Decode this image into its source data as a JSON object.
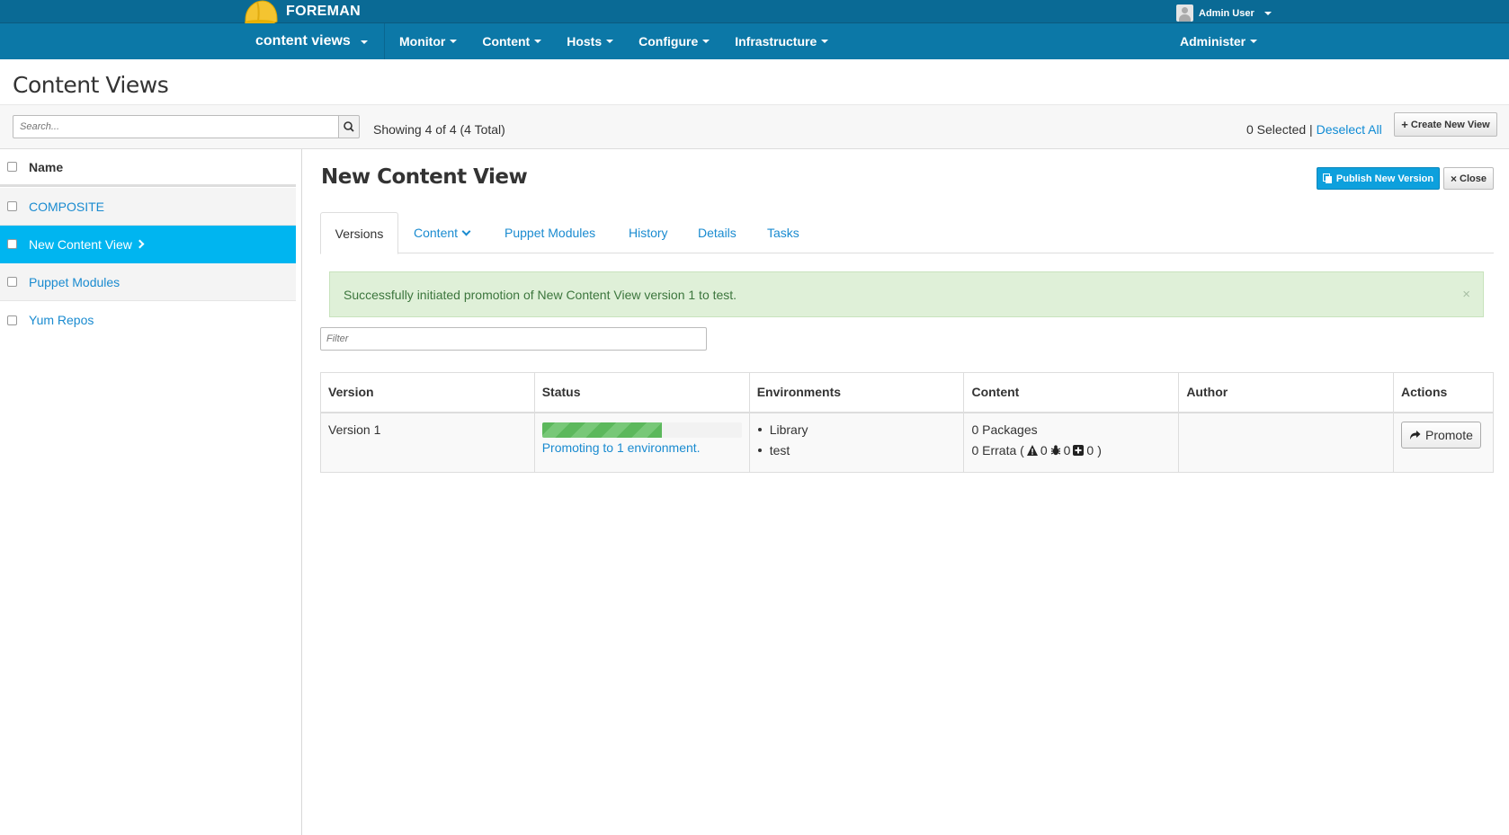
{
  "header": {
    "brand": "FOREMAN",
    "user": "Admin User"
  },
  "nav": {
    "context": "content views",
    "items": [
      "Monitor",
      "Content",
      "Hosts",
      "Configure",
      "Infrastructure"
    ],
    "admin": "Administer"
  },
  "page": {
    "title": "Content Views"
  },
  "toolbar": {
    "search_placeholder": "Search...",
    "showing": "Showing 4 of 4 (4 Total)",
    "selected": "0 Selected |",
    "deselect_all": "Deselect All",
    "create_button": "Create New View"
  },
  "list": {
    "header": "Name",
    "items": [
      {
        "label": "COMPOSITE",
        "active": false
      },
      {
        "label": "New Content View",
        "active": true
      },
      {
        "label": "Puppet Modules",
        "active": false
      },
      {
        "label": "Yum Repos",
        "active": false
      }
    ]
  },
  "detail": {
    "title": "New Content View",
    "publish_button": "Publish New Version",
    "close_button": "Close",
    "tabs": [
      "Versions",
      "Content",
      "Puppet Modules",
      "History",
      "Details",
      "Tasks"
    ],
    "active_tab": "Versions",
    "alert": "Successfully initiated promotion of New Content View version 1 to test.",
    "alert_close": "×",
    "filter_placeholder": "Filter"
  },
  "table": {
    "columns": [
      "Version",
      "Status",
      "Environments",
      "Content",
      "Author",
      "Actions"
    ],
    "rows": [
      {
        "version": "Version 1",
        "progress": 0.6,
        "status_text": "Promoting to 1 environment.",
        "environments": [
          "Library",
          "test"
        ],
        "packages": "0 Packages",
        "errata_prefix": "0 Errata (",
        "errata_security": "0",
        "errata_bugfix": "0",
        "errata_enhancement": "0",
        "errata_suffix": ")",
        "author": "",
        "action": "Promote"
      }
    ]
  },
  "colors": {
    "topbar": "#0a6a95",
    "navbar": "#0c78a7",
    "active_row": "#00b5f0",
    "link": "#1a8bd0",
    "success_bg": "#dff0d8",
    "progress": "#5cb85c"
  }
}
